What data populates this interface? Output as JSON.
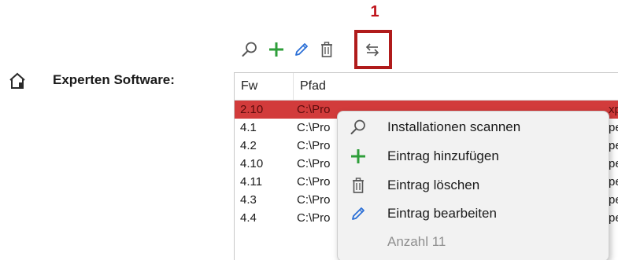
{
  "annotation": {
    "number": "1",
    "color": "#c0141b"
  },
  "toolbar": {
    "buttons": [
      {
        "icon": "search-icon"
      },
      {
        "icon": "plus-icon"
      },
      {
        "icon": "pencil-icon"
      },
      {
        "icon": "trash-icon"
      },
      {
        "icon": "swap-arrows-icon"
      }
    ]
  },
  "section": {
    "icon": "home-icon",
    "label": "Experten Software:"
  },
  "table": {
    "columns": [
      "Fw",
      "Pfad"
    ],
    "rows": [
      {
        "fw": "2.10",
        "pfad": "C:\\Pro",
        "pfad_tail": "xp",
        "selected": true
      },
      {
        "fw": "4.1",
        "pfad": "C:\\Pro",
        "pfad_tail": "pe",
        "selected": false
      },
      {
        "fw": "4.2",
        "pfad": "C:\\Pro",
        "pfad_tail": "pe",
        "selected": false
      },
      {
        "fw": "4.10",
        "pfad": "C:\\Pro",
        "pfad_tail": "pe",
        "selected": false
      },
      {
        "fw": "4.11",
        "pfad": "C:\\Pro",
        "pfad_tail": "pe",
        "selected": false
      },
      {
        "fw": "4.3",
        "pfad": "C:\\Pro",
        "pfad_tail": "pe",
        "selected": false
      },
      {
        "fw": "4.4",
        "pfad": "C:\\Pro",
        "pfad_tail": "pe",
        "selected": false
      }
    ],
    "selected_row_color": "#d23b3b"
  },
  "context_menu": {
    "items": [
      {
        "icon": "search-icon",
        "label": "Installationen scannen",
        "enabled": true
      },
      {
        "icon": "plus-icon",
        "label": "Eintrag hinzufügen",
        "enabled": true
      },
      {
        "icon": "trash-icon",
        "label": "Eintrag löschen",
        "enabled": true
      },
      {
        "icon": "pencil-icon",
        "label": "Eintrag bearbeiten",
        "enabled": true
      },
      {
        "icon": "",
        "label": "Anzahl 11",
        "enabled": false
      }
    ]
  },
  "colors": {
    "accent_green": "#2e9e3a",
    "accent_blue": "#2b6fd6",
    "icon_gray": "#555555"
  }
}
